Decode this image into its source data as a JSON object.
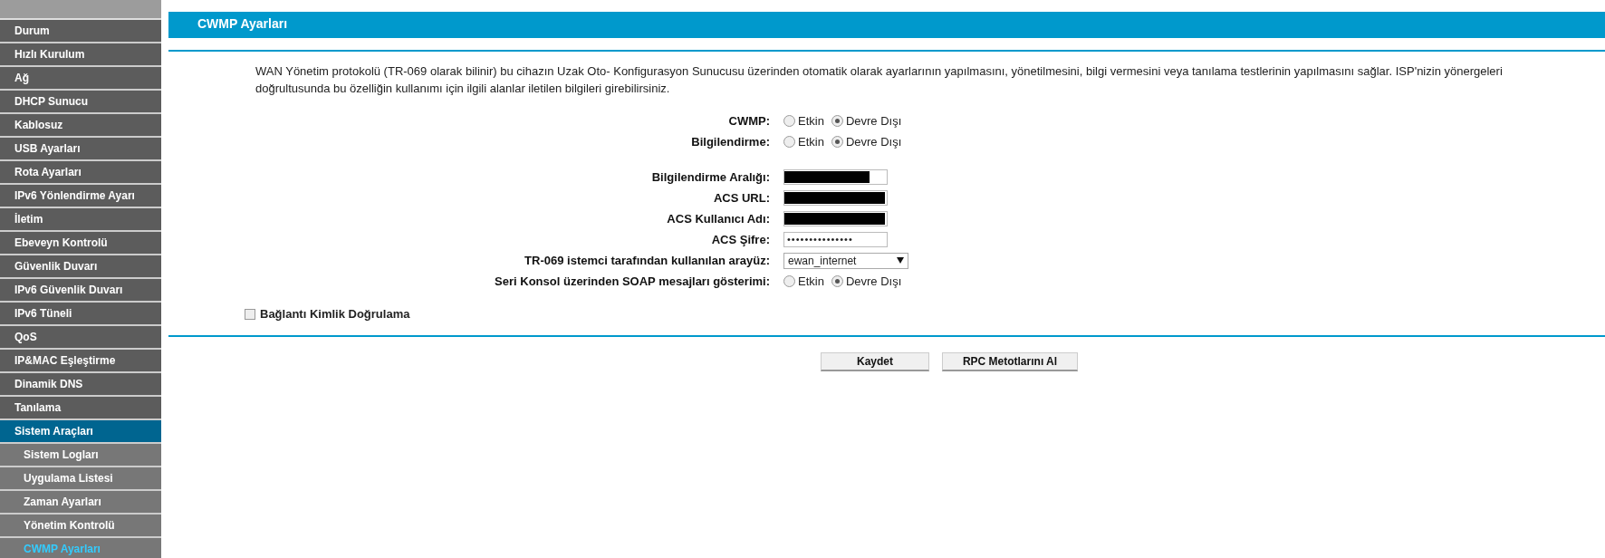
{
  "sidebar": {
    "items": [
      {
        "label": "Durum",
        "selected": false
      },
      {
        "label": "Hızlı Kurulum",
        "selected": false
      },
      {
        "label": "Ağ",
        "selected": false
      },
      {
        "label": "DHCP Sunucu",
        "selected": false
      },
      {
        "label": "Kablosuz",
        "selected": false
      },
      {
        "label": "USB Ayarları",
        "selected": false
      },
      {
        "label": "Rota Ayarları",
        "selected": false
      },
      {
        "label": "IPv6 Yönlendirme Ayarı",
        "selected": false
      },
      {
        "label": "İletim",
        "selected": false
      },
      {
        "label": "Ebeveyn Kontrolü",
        "selected": false
      },
      {
        "label": "Güvenlik Duvarı",
        "selected": false
      },
      {
        "label": "IPv6 Güvenlik Duvarı",
        "selected": false
      },
      {
        "label": "IPv6 Tüneli",
        "selected": false
      },
      {
        "label": "QoS",
        "selected": false
      },
      {
        "label": "IP&MAC Eşleştirme",
        "selected": false
      },
      {
        "label": "Dinamik DNS",
        "selected": false
      },
      {
        "label": "Tanılama",
        "selected": false
      },
      {
        "label": "Sistem Araçları",
        "selected": true,
        "children": [
          {
            "label": "Sistem Logları",
            "selected": false
          },
          {
            "label": "Uygulama Listesi",
            "selected": false
          },
          {
            "label": "Zaman Ayarları",
            "selected": false
          },
          {
            "label": "Yönetim Kontrolü",
            "selected": false
          },
          {
            "label": "CWMP Ayarları",
            "selected": true
          }
        ]
      }
    ]
  },
  "page": {
    "title": "CWMP Ayarları",
    "description": "WAN Yönetim protokolü (TR-069 olarak bilinir) bu cihazın Uzak Oto- Konfigurasyon Sunucusu üzerinden otomatik olarak ayarlarının yapılmasını, yönetilmesini, bilgi vermesini veya tanılama testlerinin yapılmasını sağlar. ISP'nizin yönergeleri doğrultusunda bu özelliğin kullanımı için ilgili alanlar iletilen bilgileri girebilirsiniz.",
    "fields": [
      {
        "kind": "radio",
        "label": "CWMP:",
        "options": [
          {
            "label": "Etkin",
            "selected": false
          },
          {
            "label": "Devre Dışı",
            "selected": true
          }
        ]
      },
      {
        "kind": "radio",
        "label": "Bilgilendirme:",
        "options": [
          {
            "label": "Etkin",
            "selected": false
          },
          {
            "label": "Devre Dışı",
            "selected": true
          }
        ]
      },
      {
        "kind": "spacer"
      },
      {
        "kind": "redacted",
        "label": "Bilgilendirme Aralığı:",
        "level": 0.85
      },
      {
        "kind": "redacted",
        "label": "ACS URL:",
        "level": 1
      },
      {
        "kind": "redacted",
        "label": "ACS Kullanıcı Adı:",
        "level": 1
      },
      {
        "kind": "password",
        "label": "ACS  Şifre:",
        "value": "•••••••••••••••"
      },
      {
        "kind": "select",
        "label": "TR-069 istemci tarafından kullanılan arayüz:",
        "value": "ewan_internet"
      },
      {
        "kind": "radio",
        "label": "Seri Konsol üzerinden SOAP mesajları gösterimi:",
        "options": [
          {
            "label": "Etkin",
            "selected": false
          },
          {
            "label": "Devre Dışı",
            "selected": true
          }
        ]
      }
    ],
    "auth_checkbox": {
      "label": "Bağlantı Kimlik Doğrulama",
      "checked": false
    },
    "buttons": [
      "Kaydet",
      "RPC Metotlarını Al"
    ]
  }
}
